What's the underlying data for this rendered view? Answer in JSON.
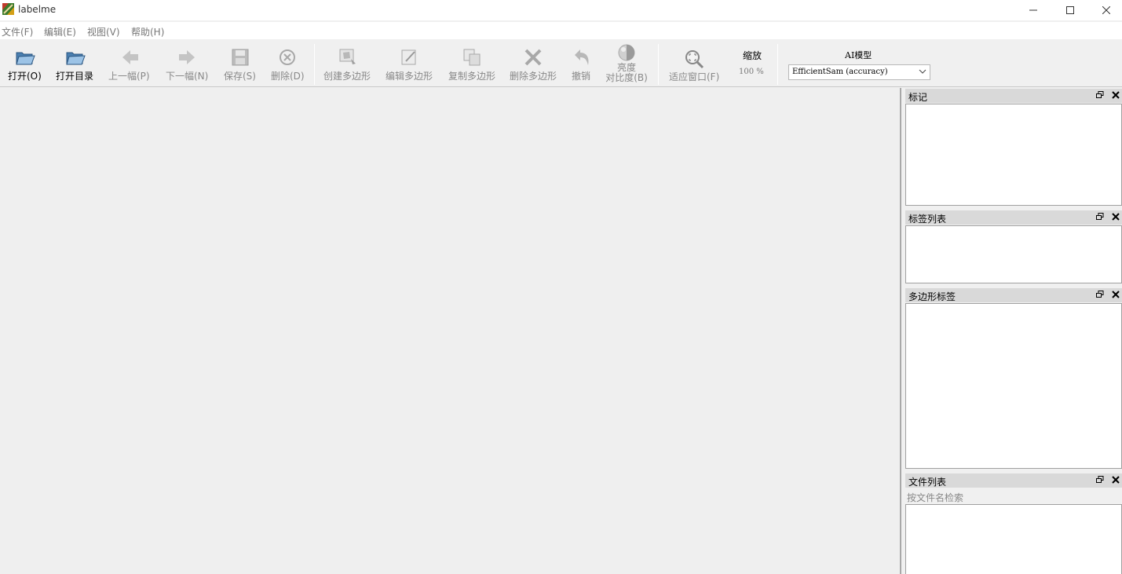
{
  "window": {
    "title": "labelme",
    "controls": [
      "minimize-icon",
      "maximize-icon",
      "close-icon"
    ]
  },
  "menu": {
    "items": [
      {
        "label": "文件(F)"
      },
      {
        "label": "编辑(E)"
      },
      {
        "label": "视图(V)"
      },
      {
        "label": "帮助(H)"
      }
    ]
  },
  "toolbar": {
    "open": {
      "label": "打开(O)",
      "icon": "folder-open-icon"
    },
    "open_dir": {
      "label": "打开目录",
      "icon": "folder-open-icon"
    },
    "prev": {
      "label": "上一幅(P)",
      "icon": "arrow-left-icon"
    },
    "next": {
      "label": "下一幅(N)",
      "icon": "arrow-right-icon"
    },
    "save": {
      "label": "保存(S)",
      "icon": "floppy-disk-icon"
    },
    "delete": {
      "label": "删除(D)",
      "icon": "circle-x-icon"
    },
    "create_polygon": {
      "label": "创建多边形",
      "icon": "create-polygon-icon"
    },
    "edit_polygon": {
      "label": "编辑多边形",
      "icon": "edit-polygon-icon"
    },
    "copy_polygon": {
      "label": "复制多边形",
      "icon": "copy-polygon-icon"
    },
    "delete_polygon": {
      "label": "删除多边形",
      "icon": "cross-icon"
    },
    "undo": {
      "label": "撤销",
      "icon": "undo-icon"
    },
    "brightness_line1": "亮度",
    "brightness_line2": "对比度(B)",
    "brightness_icon": "brightness-contrast-icon",
    "fit_window": {
      "label": "适应窗口(F)",
      "icon": "zoom-fit-icon"
    },
    "zoom": {
      "title": "缩放",
      "value": "100 %"
    },
    "ai_model": {
      "title": "AI模型",
      "selected": "EfficientSam (accuracy)"
    }
  },
  "docks": {
    "flags": {
      "title": "标记"
    },
    "label_list": {
      "title": "标签列表"
    },
    "polygon_labels": {
      "title": "多边形标签"
    },
    "file_list": {
      "title": "文件列表",
      "search_placeholder": "按文件名检索"
    }
  },
  "colors": {
    "background": "#f0f0f0",
    "disabled_text": "#888888",
    "dock_title_bg": "#d9d9d9"
  }
}
